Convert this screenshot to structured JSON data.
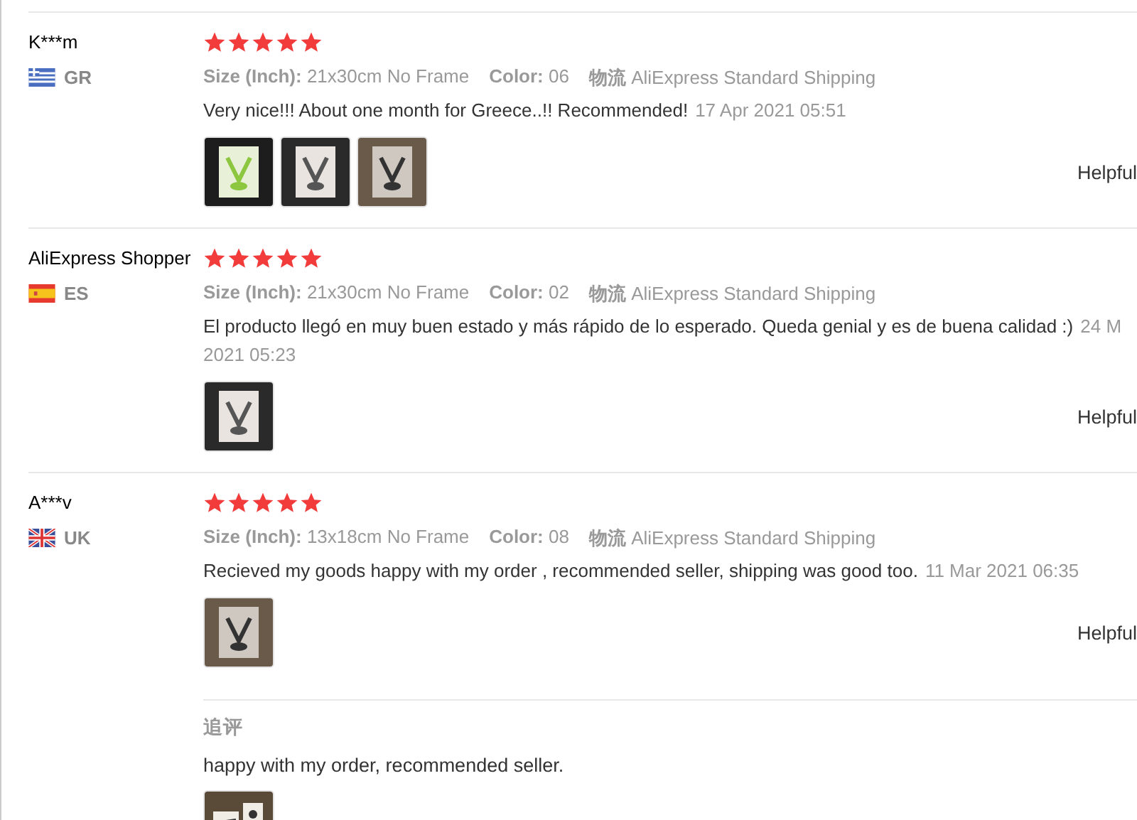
{
  "reviews": [
    {
      "name": "K***m",
      "country": {
        "kind": "gr",
        "code": "GR"
      },
      "stars": 5,
      "specs": [
        {
          "label": "Size (Inch):",
          "value": "21x30cm No Frame"
        },
        {
          "label": "Color:",
          "value": "06"
        },
        {
          "label": "物流",
          "value": "AliExpress Standard Shipping"
        }
      ],
      "text": "Very nice!!! About one month for Greece..!! Recommended!",
      "date": [
        "17 Apr 2021 05:51"
      ],
      "photos": [
        {
          "kind": "picture"
        },
        {
          "kind": "picture"
        },
        {
          "kind": "picture"
        }
      ],
      "helpful": "Helpful"
    },
    {
      "name": "AliExpress Shopper",
      "country": {
        "kind": "es",
        "code": "ES"
      },
      "stars": 5,
      "specs": [
        {
          "label": "Size (Inch):",
          "value": "21x30cm No Frame"
        },
        {
          "label": "Color:",
          "value": "02"
        },
        {
          "label": "物流",
          "value": "AliExpress Standard Shipping"
        }
      ],
      "text": "El producto llegó en muy buen estado y más rápido de lo esperado. Queda genial y es de buena calidad :)",
      "date": [
        "24 M",
        "2021 05:23"
      ],
      "photos": [
        {
          "kind": "picture"
        }
      ],
      "helpful": "Helpful"
    },
    {
      "name": "A***v",
      "country": {
        "kind": "uk",
        "code": "UK"
      },
      "stars": 5,
      "specs": [
        {
          "label": "Size (Inch):",
          "value": "13x18cm No Frame"
        },
        {
          "label": "Color:",
          "value": "08"
        },
        {
          "label": "物流",
          "value": "AliExpress Standard Shipping"
        }
      ],
      "text": "Recieved my goods happy with my order , recommended seller, shipping was good too.",
      "date": [
        "11 Mar 2021 06:35"
      ],
      "photos": [
        {
          "kind": "picture"
        }
      ],
      "helpful": "Helpful",
      "followup": {
        "label": "追评",
        "text": "happy with my order, recommended seller.",
        "photos": [
          {
            "kind": "picture"
          }
        ]
      }
    }
  ]
}
